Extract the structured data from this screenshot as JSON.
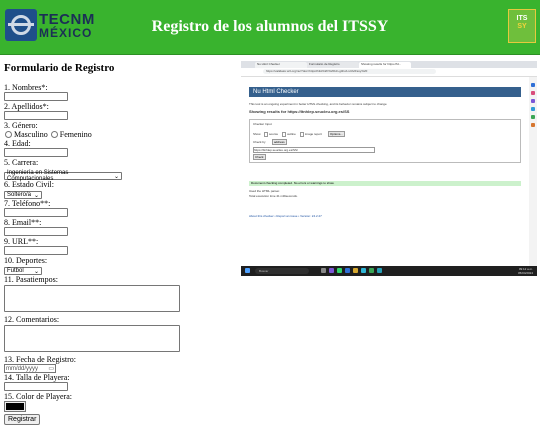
{
  "header": {
    "title": "Registro de los alumnos del ITSSY",
    "logo_left_line1": "TECNM",
    "logo_left_line2": "MÉXICO",
    "logo_right_line1": "ITS",
    "logo_right_line2": "SY",
    "brand_color": "#39b32e"
  },
  "form": {
    "heading": "Formulario de Registro",
    "fields": {
      "nombres": "1. Nombres*:",
      "apellidos": "2. Apellidos*:",
      "genero": "3. Género:",
      "genero_m": "Masculino",
      "genero_f": "Femenino",
      "edad": "4. Edad:",
      "carrera": "5. Carrera:",
      "carrera_value": "Ingeniería en Sistemas Computacionales",
      "estado_civil": "6. Estado Civil:",
      "estado_civil_value": "Soltero/a",
      "telefono": "7. Teléfono**:",
      "email": "8. Email**:",
      "url": "9. URL**:",
      "deportes": "10. Deportes:",
      "deportes_value": "Futbol",
      "pasatiempos": "11. Pasatiempos:",
      "comentarios": "12. Comentarios:",
      "fecha": "13. Fecha de Registro:",
      "fecha_placeholder": "mm/dd/yyyy",
      "talla": "14. Talla de Playera:",
      "color": "15. Color de Playera:",
      "color_value": "#000000"
    },
    "submit_label": "Registrar"
  },
  "screenshot": {
    "tab1": "Nu Html Checker",
    "tab2": "Formulario de Registro",
    "tab3": "Showing results for https://ld...",
    "address": "https://validator.w3.org/nu/?doc=https%3A%2F%2Fldn.github.io%2Fssy%2F",
    "page_title": "Nu Html Checker",
    "intro": "This tool is an ongoing experiment in better HTML checking, and its behavior remains subject to change",
    "results_for": "Showing results for https://ltnhlep.seucleu.org.es/SS",
    "checker_input": "Checker Input",
    "show_label": "Show",
    "opt_source": "source",
    "opt_outline": "outline",
    "opt_image": "image report",
    "options_btn": "Options...",
    "check_by": "Check by",
    "check_by_value": "address",
    "check_url": "https://ltnhlep.seucleu.org.es/SS/",
    "check_btn": "Check",
    "status": "Document checking completed. No errors or warnings to show.",
    "line1": "Used the HTML parser.",
    "line2": "Total execution time 41 milliseconds.",
    "footer": "About this checker • Report an issue • Version: 24.2.27",
    "taskbar_search": "Buscar",
    "clock_time": "09:12 a.m.",
    "clock_date": "05/04/2024"
  }
}
